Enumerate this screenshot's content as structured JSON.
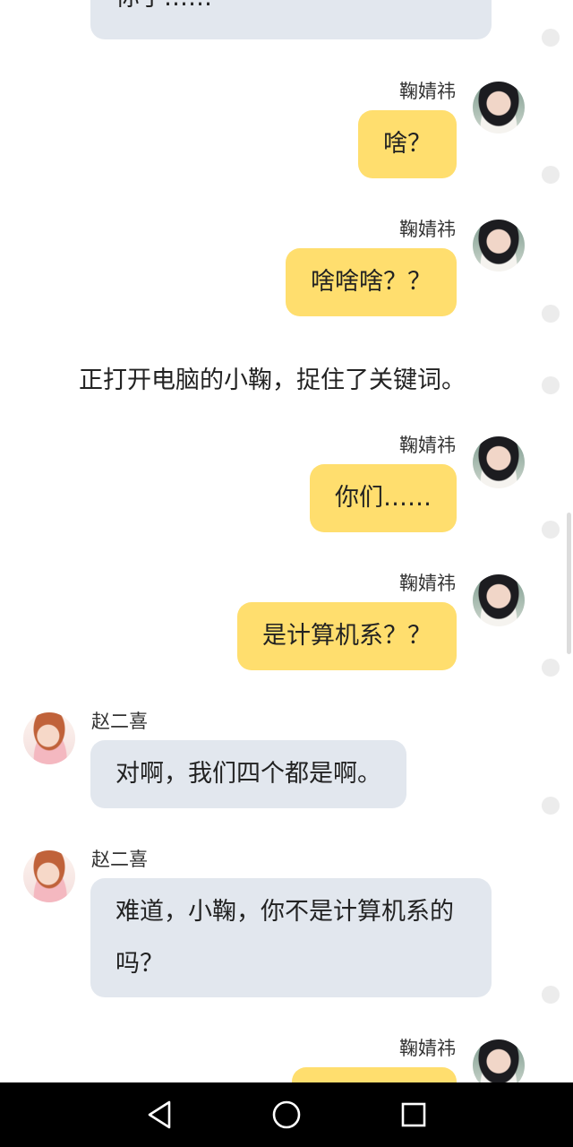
{
  "messages": [
    {
      "sender": "",
      "text": "你了……"
    },
    {
      "sender": "鞠婧祎",
      "text": "啥？"
    },
    {
      "sender": "鞠婧祎",
      "text": "啥啥啥？？"
    },
    {
      "narration": "正打开电脑的小鞠，捉住了关键词。"
    },
    {
      "sender": "鞠婧祎",
      "text": "你们……"
    },
    {
      "sender": "鞠婧祎",
      "text": "是计算机系？？"
    },
    {
      "sender": "赵二喜",
      "text": "对啊，我们四个都是啊。"
    },
    {
      "sender": "赵二喜",
      "text": "难道，小鞠，你不是计算机系的吗？"
    },
    {
      "sender": "鞠婧祎",
      "text": ""
    }
  ],
  "nav": {
    "back_icon": "back-triangle-icon",
    "home_icon": "home-circle-icon",
    "recents_icon": "recents-square-icon"
  },
  "colors": {
    "my_bubble": "#ffde6e",
    "other_bubble": "#e2e7ee",
    "navbar": "#000000"
  }
}
